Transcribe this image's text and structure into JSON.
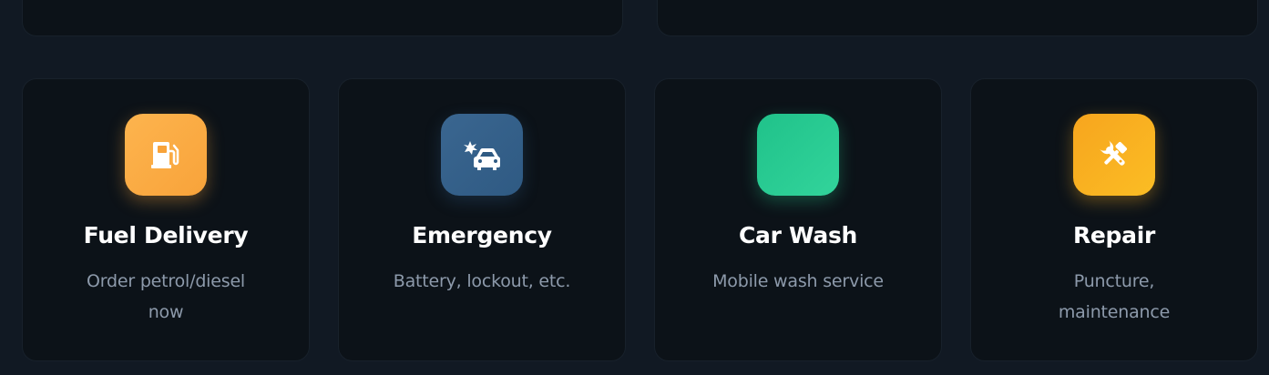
{
  "services": [
    {
      "title": "Fuel Delivery",
      "description": "Order petrol/diesel now",
      "icon": "fuel-pump-icon",
      "color": "#fdb44e"
    },
    {
      "title": "Emergency",
      "description": "Battery, lockout, etc.",
      "icon": "car-crash-icon",
      "color": "#3a6690"
    },
    {
      "title": "Car Wash",
      "description": "Mobile wash service",
      "icon": "none",
      "color": "#20c28a"
    },
    {
      "title": "Repair",
      "description": "Puncture, maintenance",
      "icon": "tools-icon",
      "color": "#f7a51e"
    }
  ],
  "colors": {
    "background": "#111923",
    "card": "#0c1218",
    "title": "#ffffff",
    "description": "#8d9aab"
  }
}
